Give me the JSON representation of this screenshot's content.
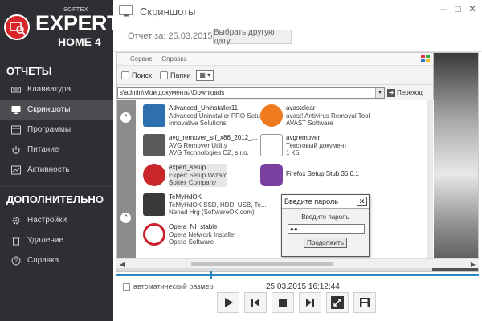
{
  "window": {
    "controls": [
      "–",
      "□",
      "✕"
    ]
  },
  "brand": {
    "softex": "SOFTEX",
    "expert": "EXPERT",
    "home": "HOME 4"
  },
  "sidebar": {
    "section_reports": "ОТЧЕТЫ",
    "reports": [
      {
        "label": "Клавиатура",
        "icon": "keyboard-icon"
      },
      {
        "label": "Скриншоты",
        "icon": "monitor-icon",
        "active": true
      },
      {
        "label": "Программы",
        "icon": "programs-icon"
      },
      {
        "label": "Питание",
        "icon": "power-icon"
      },
      {
        "label": "Активность",
        "icon": "activity-icon"
      }
    ],
    "section_extra": "ДОПОЛНИТЕЛЬНО",
    "extra": [
      {
        "label": "Настройки",
        "icon": "gear-icon"
      },
      {
        "label": "Удаление",
        "icon": "trash-icon"
      },
      {
        "label": "Справка",
        "icon": "help-icon"
      }
    ]
  },
  "header": {
    "title": "Скриншоты"
  },
  "report": {
    "date_label": "Отчет за: 25.03.2015",
    "change_date_button": "Выбрать другую дату"
  },
  "screenshot": {
    "menu": [
      "Сервис",
      "Справка"
    ],
    "toolbar": {
      "search": "Поиск",
      "folders": "Папки",
      "view": "▦ ▾"
    },
    "address": {
      "path": "s\\admin\\Мои документы\\Downloads",
      "go": "Переход"
    },
    "files": [
      {
        "name": "Advanced_Uninstaller11",
        "line2": "Advanced Uninstaller PRO Setup",
        "line3": "Innovative Solutions",
        "color": "#2e6fb0"
      },
      {
        "name": "avastclear",
        "line2": "avast! Antivirus Removal Tool",
        "line3": "AVAST Software",
        "color": "#f07b1f"
      },
      {
        "name": "avg_remover_stf_x86_2012_...",
        "line2": "AVG Remover Utility",
        "line3": "AVG Technologies CZ, s.r.o.",
        "color": "#5a5a5a"
      },
      {
        "name": "avgremover",
        "line2": "Текстовый документ",
        "line3": "1 КБ",
        "color": "#d9d9d9"
      },
      {
        "name": "expert_setup",
        "line2": "Expert Setup Wizard",
        "line3": "Softex Company",
        "color": "#c9262b"
      },
      {
        "name": "Firefox Setup Stub 36.0.1",
        "line2": "",
        "line3": "",
        "color": "#7a3fa0"
      },
      {
        "name": "TeMyHdOK",
        "line2": "TeMyHdOK SSD, HDD, USB, Te...",
        "line3": "Nenad Hrg (SoftwareOK.com)",
        "color": "#3a3a3a"
      },
      {
        "name": "Opera_NI_stable",
        "line2": "Opera Network Installer",
        "line3": "Opera Software",
        "color": "#cc1f2b"
      }
    ],
    "dialog": {
      "title": "Введите пароль",
      "label": "Введите пароль",
      "value": "●●",
      "button": "Продолжить"
    }
  },
  "playback": {
    "auto_size": "автоматический размер",
    "timestamp": "25.03.2015 16:12:44",
    "progress": 0.26
  }
}
